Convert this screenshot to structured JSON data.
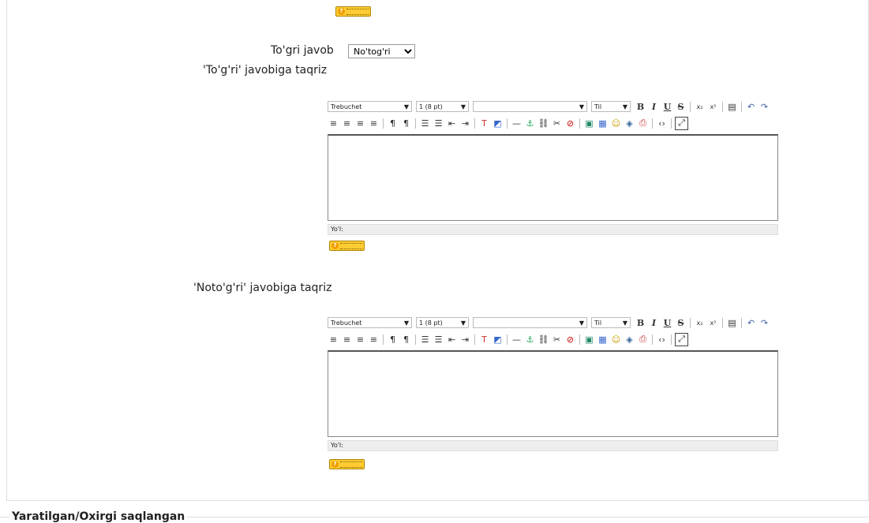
{
  "form": {
    "correct_answer_label": "To'gri javob",
    "correct_answer_value": "No'tog'ri",
    "correct_answer_options": [
      "No'tog'ri"
    ],
    "feedback_true_label": "'To'g'ri' javobiga taqriz",
    "feedback_false_label": "'Noto'g'ri' javobiga taqriz"
  },
  "editor": {
    "font_family": "Trebuchet",
    "font_size": "1 (8 pt)",
    "format": "",
    "language": "Til",
    "path_label": "Yo'l:",
    "buttons": {
      "bold": "B",
      "italic": "I",
      "underline": "U",
      "strike": "S",
      "subscript": "x₂",
      "superscript": "x²"
    }
  },
  "section": {
    "legend": "Yaratilgan/Oxirgi saqlangan"
  },
  "icons": {
    "help": "help-icon"
  }
}
